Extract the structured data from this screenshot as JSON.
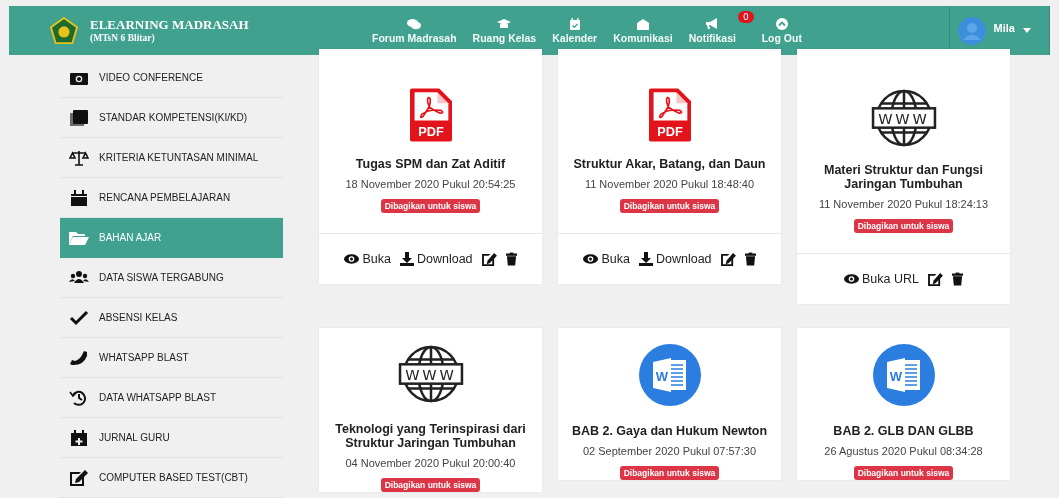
{
  "header": {
    "title": "ELEARNING MADRASAH",
    "subtitle": "(MTsN 6 Blitar)",
    "nav": [
      {
        "label": "Forum Madrasah",
        "kind": "forum"
      },
      {
        "label": "Ruang Kelas",
        "kind": "class"
      },
      {
        "label": "Kalender",
        "kind": "calendar"
      },
      {
        "label": "Komunikasi",
        "kind": "messages"
      },
      {
        "label": "Notifikasi",
        "kind": "notifications",
        "badge": "0"
      },
      {
        "label": "Log Out",
        "kind": "logout"
      }
    ],
    "user": {
      "name": "Mila"
    }
  },
  "sidebar": {
    "items": [
      {
        "label": "VIDEO CONFERENCE",
        "kind": "video",
        "selected": false
      },
      {
        "label": "STANDAR KOMPETENSI(KI/KD)",
        "kind": "competency",
        "selected": false
      },
      {
        "label": "KRITERIA KETUNTASAN MINIMAL",
        "kind": "criteria",
        "selected": false
      },
      {
        "label": "RENCANA PEMBELAJARAN",
        "kind": "plan",
        "selected": false
      },
      {
        "label": "BAHAN AJAR",
        "kind": "materials",
        "selected": true
      },
      {
        "label": "DATA SISWA TERGABUNG",
        "kind": "students",
        "selected": false
      },
      {
        "label": "ABSENSI KELAS",
        "kind": "attendance",
        "selected": false
      },
      {
        "label": "WHATSAPP BLAST",
        "kind": "blast",
        "selected": false
      },
      {
        "label": "DATA WHATSAPP BLAST",
        "kind": "blasthistory",
        "selected": false
      },
      {
        "label": "JURNAL GURU",
        "kind": "journal",
        "selected": false
      },
      {
        "label": "COMPUTER BASED TEST(CBT)",
        "kind": "cbt",
        "selected": false
      }
    ]
  },
  "cards": [
    {
      "kind": "pdf",
      "icon_label": "PDF",
      "title": "Tugas SPM dan Zat Aditif",
      "date": "18 November 2020 Pukul 20:54:25",
      "badge": "Dibagikan untuk siswa",
      "actions": [
        {
          "kind": "view",
          "label": "Buka"
        },
        {
          "kind": "download",
          "label": "Download"
        },
        {
          "kind": "edit"
        },
        {
          "kind": "delete"
        }
      ]
    },
    {
      "kind": "pdf",
      "icon_label": "PDF",
      "title": "Struktur Akar, Batang, dan Daun",
      "date": "11 November 2020 Pukul 18:48:40",
      "badge": "Dibagikan untuk siswa",
      "actions": [
        {
          "kind": "view",
          "label": "Buka"
        },
        {
          "kind": "download",
          "label": "Download"
        },
        {
          "kind": "edit"
        },
        {
          "kind": "delete"
        }
      ]
    },
    {
      "kind": "url",
      "icon_label": "WWW",
      "title": "Materi Struktur dan Fungsi Jaringan Tumbuhan",
      "date": "11 November 2020 Pukul 18:24:13",
      "badge": "Dibagikan untuk siswa",
      "actions": [
        {
          "kind": "view",
          "label": "Buka URL"
        },
        {
          "kind": "edit"
        },
        {
          "kind": "delete"
        }
      ]
    },
    {
      "kind": "url",
      "icon_label": "WWW",
      "title": "Teknologi yang Terinspirasi dari Struktur Jaringan Tumbuhan",
      "date": "04 November 2020 Pukul 20:00:40",
      "badge": "Dibagikan untuk siswa"
    },
    {
      "kind": "word",
      "icon_label": "W",
      "title": "BAB 2. Gaya dan Hukum Newton",
      "date": "02 September 2020 Pukul 07:57:30",
      "badge": "Dibagikan untuk siswa"
    },
    {
      "kind": "word",
      "icon_label": "W",
      "title": "BAB 2. GLB DAN GLBB",
      "date": "26 Agustus 2020 Pukul 08:34:28",
      "badge": "Dibagikan untuk siswa"
    }
  ]
}
